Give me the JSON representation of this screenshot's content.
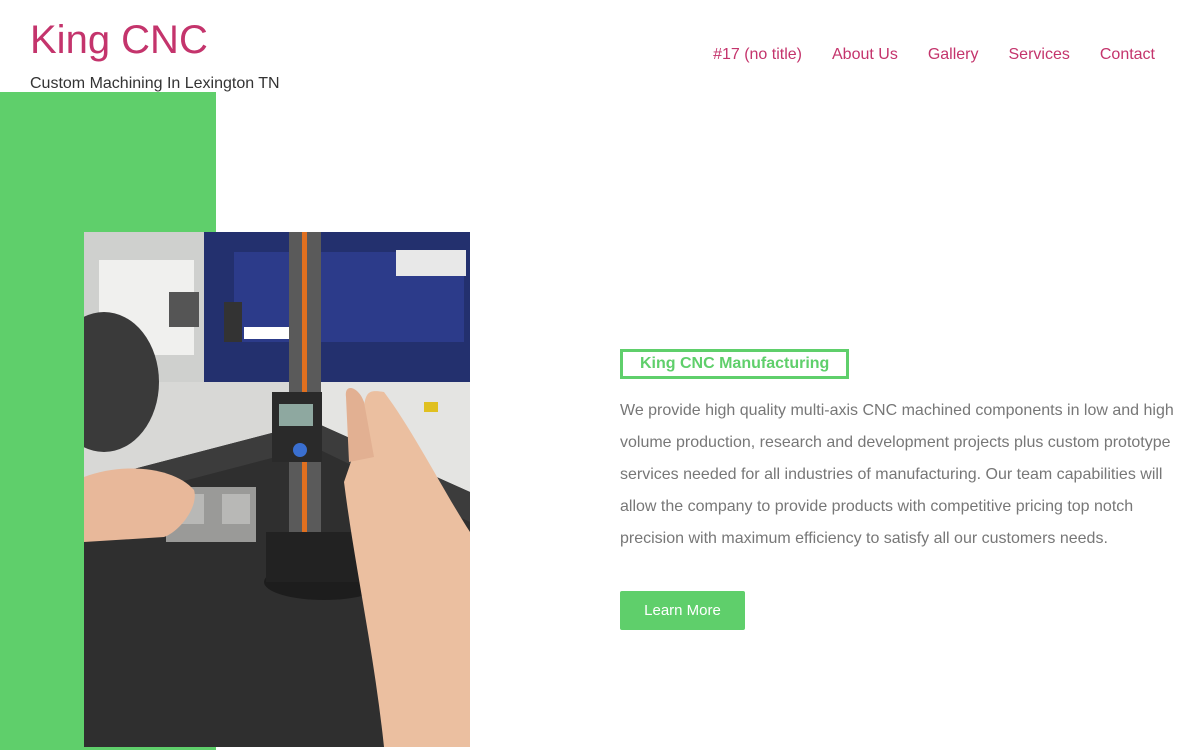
{
  "header": {
    "site_title": "King CNC",
    "tagline": "Custom Machining In Lexington TN",
    "nav": [
      "#17 (no title)",
      "About Us",
      "Gallery",
      "Services",
      "Contact"
    ]
  },
  "hero": {
    "heading": "King CNC Manufacturing",
    "body": "We provide high quality multi-axis CNC machined  components in low and high volume production, research and development projects plus custom prototype services needed for all industries of manufacturing. Our team capabilities will allow the company to provide products with competitive pricing top notch precision with maximum efficiency to satisfy all our customers needs.",
    "button_label": "Learn More"
  },
  "colors": {
    "brand": "#c4346c",
    "accent": "#5fcf6b",
    "body_text": "#777777"
  }
}
